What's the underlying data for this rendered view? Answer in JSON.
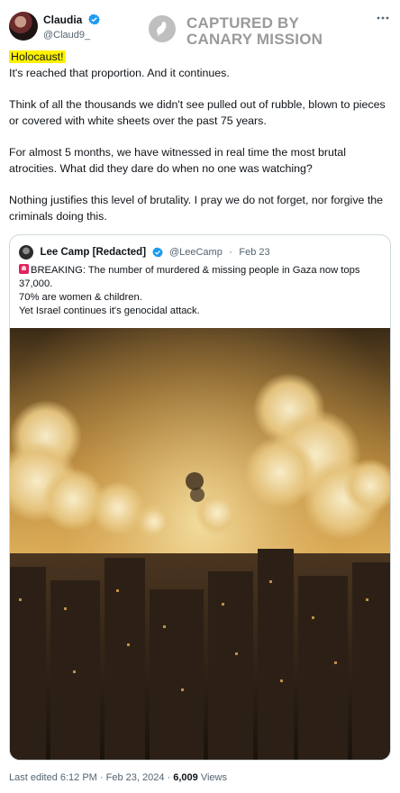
{
  "author": {
    "display_name": "Claudia",
    "handle": "@Claud9_"
  },
  "watermark": {
    "line1": "CAPTURED BY",
    "line2": "CANARY MISSION"
  },
  "tweet": {
    "highlight": "Holocaust!",
    "paragraphs": [
      "It's reached that proportion. And it continues.",
      "Think of all the thousands we didn't see pulled out of rubble, blown to pieces or covered with white sheets  over the past 75 years.",
      "For almost 5 months, we have witnessed in real time the most brutal atrocities. What did they dare do when no one was watching?",
      "Nothing justifies this level of brutality. I pray we do not forget, nor forgive the criminals doing this."
    ]
  },
  "quoted": {
    "display_name": "Lee Camp [Redacted]",
    "handle": "@LeeCamp",
    "separator": "·",
    "date": "Feb 23",
    "lines": [
      "BREAKING: The number of murdered & missing people in Gaza now tops 37,000.",
      "70% are women & children.",
      "Yet Israel continues it's genocidal attack."
    ],
    "image_alt": "night skyline with smoke clouds over city"
  },
  "footer": {
    "edited": "Last edited 6:12 PM · Feb 23, 2024 · ",
    "views_count": "6,009",
    "views_label": " Views"
  },
  "colors": {
    "verified": "#1d9bf0",
    "text": "#0f1419",
    "muted": "#536471",
    "highlight": "#fff200",
    "watermark": "#9a9a9a"
  }
}
